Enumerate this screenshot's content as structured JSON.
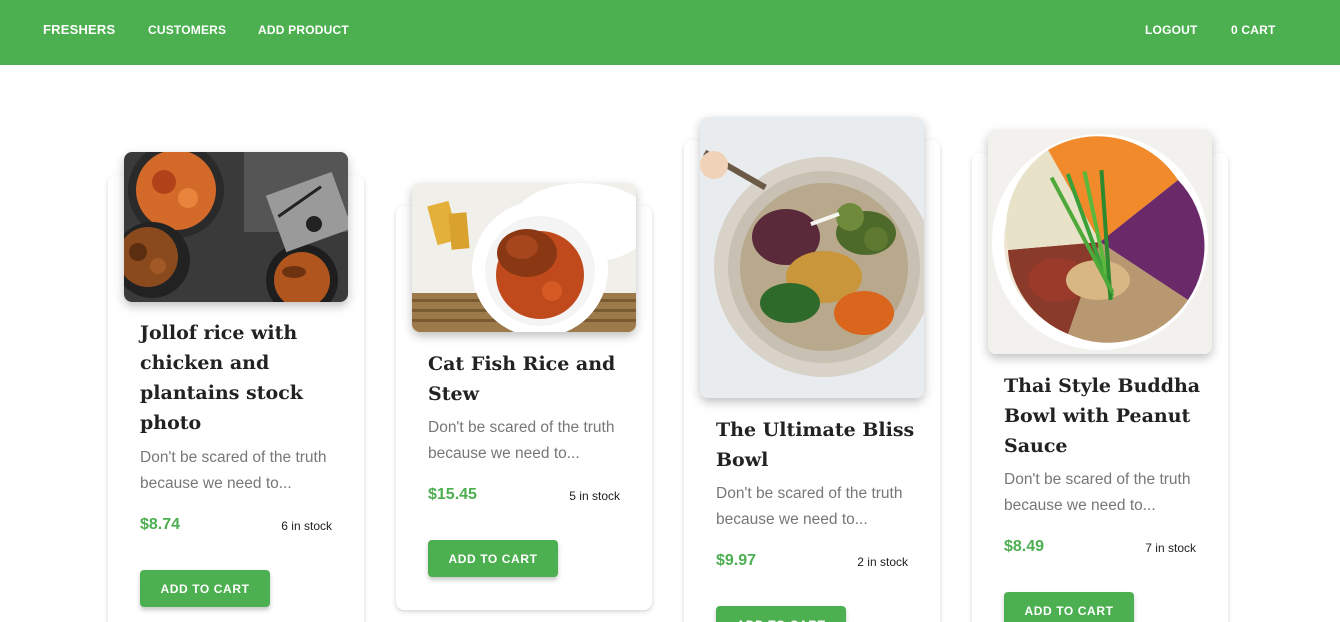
{
  "navbar": {
    "brand": "FRESHERS",
    "links": [
      "CUSTOMERS",
      "ADD PRODUCT"
    ],
    "logout": "LOGOUT",
    "cart": "0 CART",
    "color": "#4caf50"
  },
  "products": [
    {
      "title": "Jollof rice with chicken and plantains stock photo",
      "description": "Don't be scared of the truth because we need to...",
      "price": "$8.74",
      "stock": "6 in stock",
      "button": "ADD TO CART"
    },
    {
      "title": "Cat Fish Rice and Stew",
      "description": "Don't be scared of the truth because we need to...",
      "price": "$15.45",
      "stock": "5 in stock",
      "button": "ADD TO CART"
    },
    {
      "title": "The Ultimate Bliss Bowl",
      "description": "Don't be scared of the truth because we need to...",
      "price": "$9.97",
      "stock": "2 in stock",
      "button": "ADD TO CART"
    },
    {
      "title": "Thai Style Buddha Bowl with Peanut Sauce",
      "description": "Don't be scared of the truth because we need to...",
      "price": "$8.49",
      "stock": "7 in stock",
      "button": "ADD TO CART"
    }
  ],
  "colors": {
    "accent": "#4caf50",
    "description": "#777777"
  }
}
